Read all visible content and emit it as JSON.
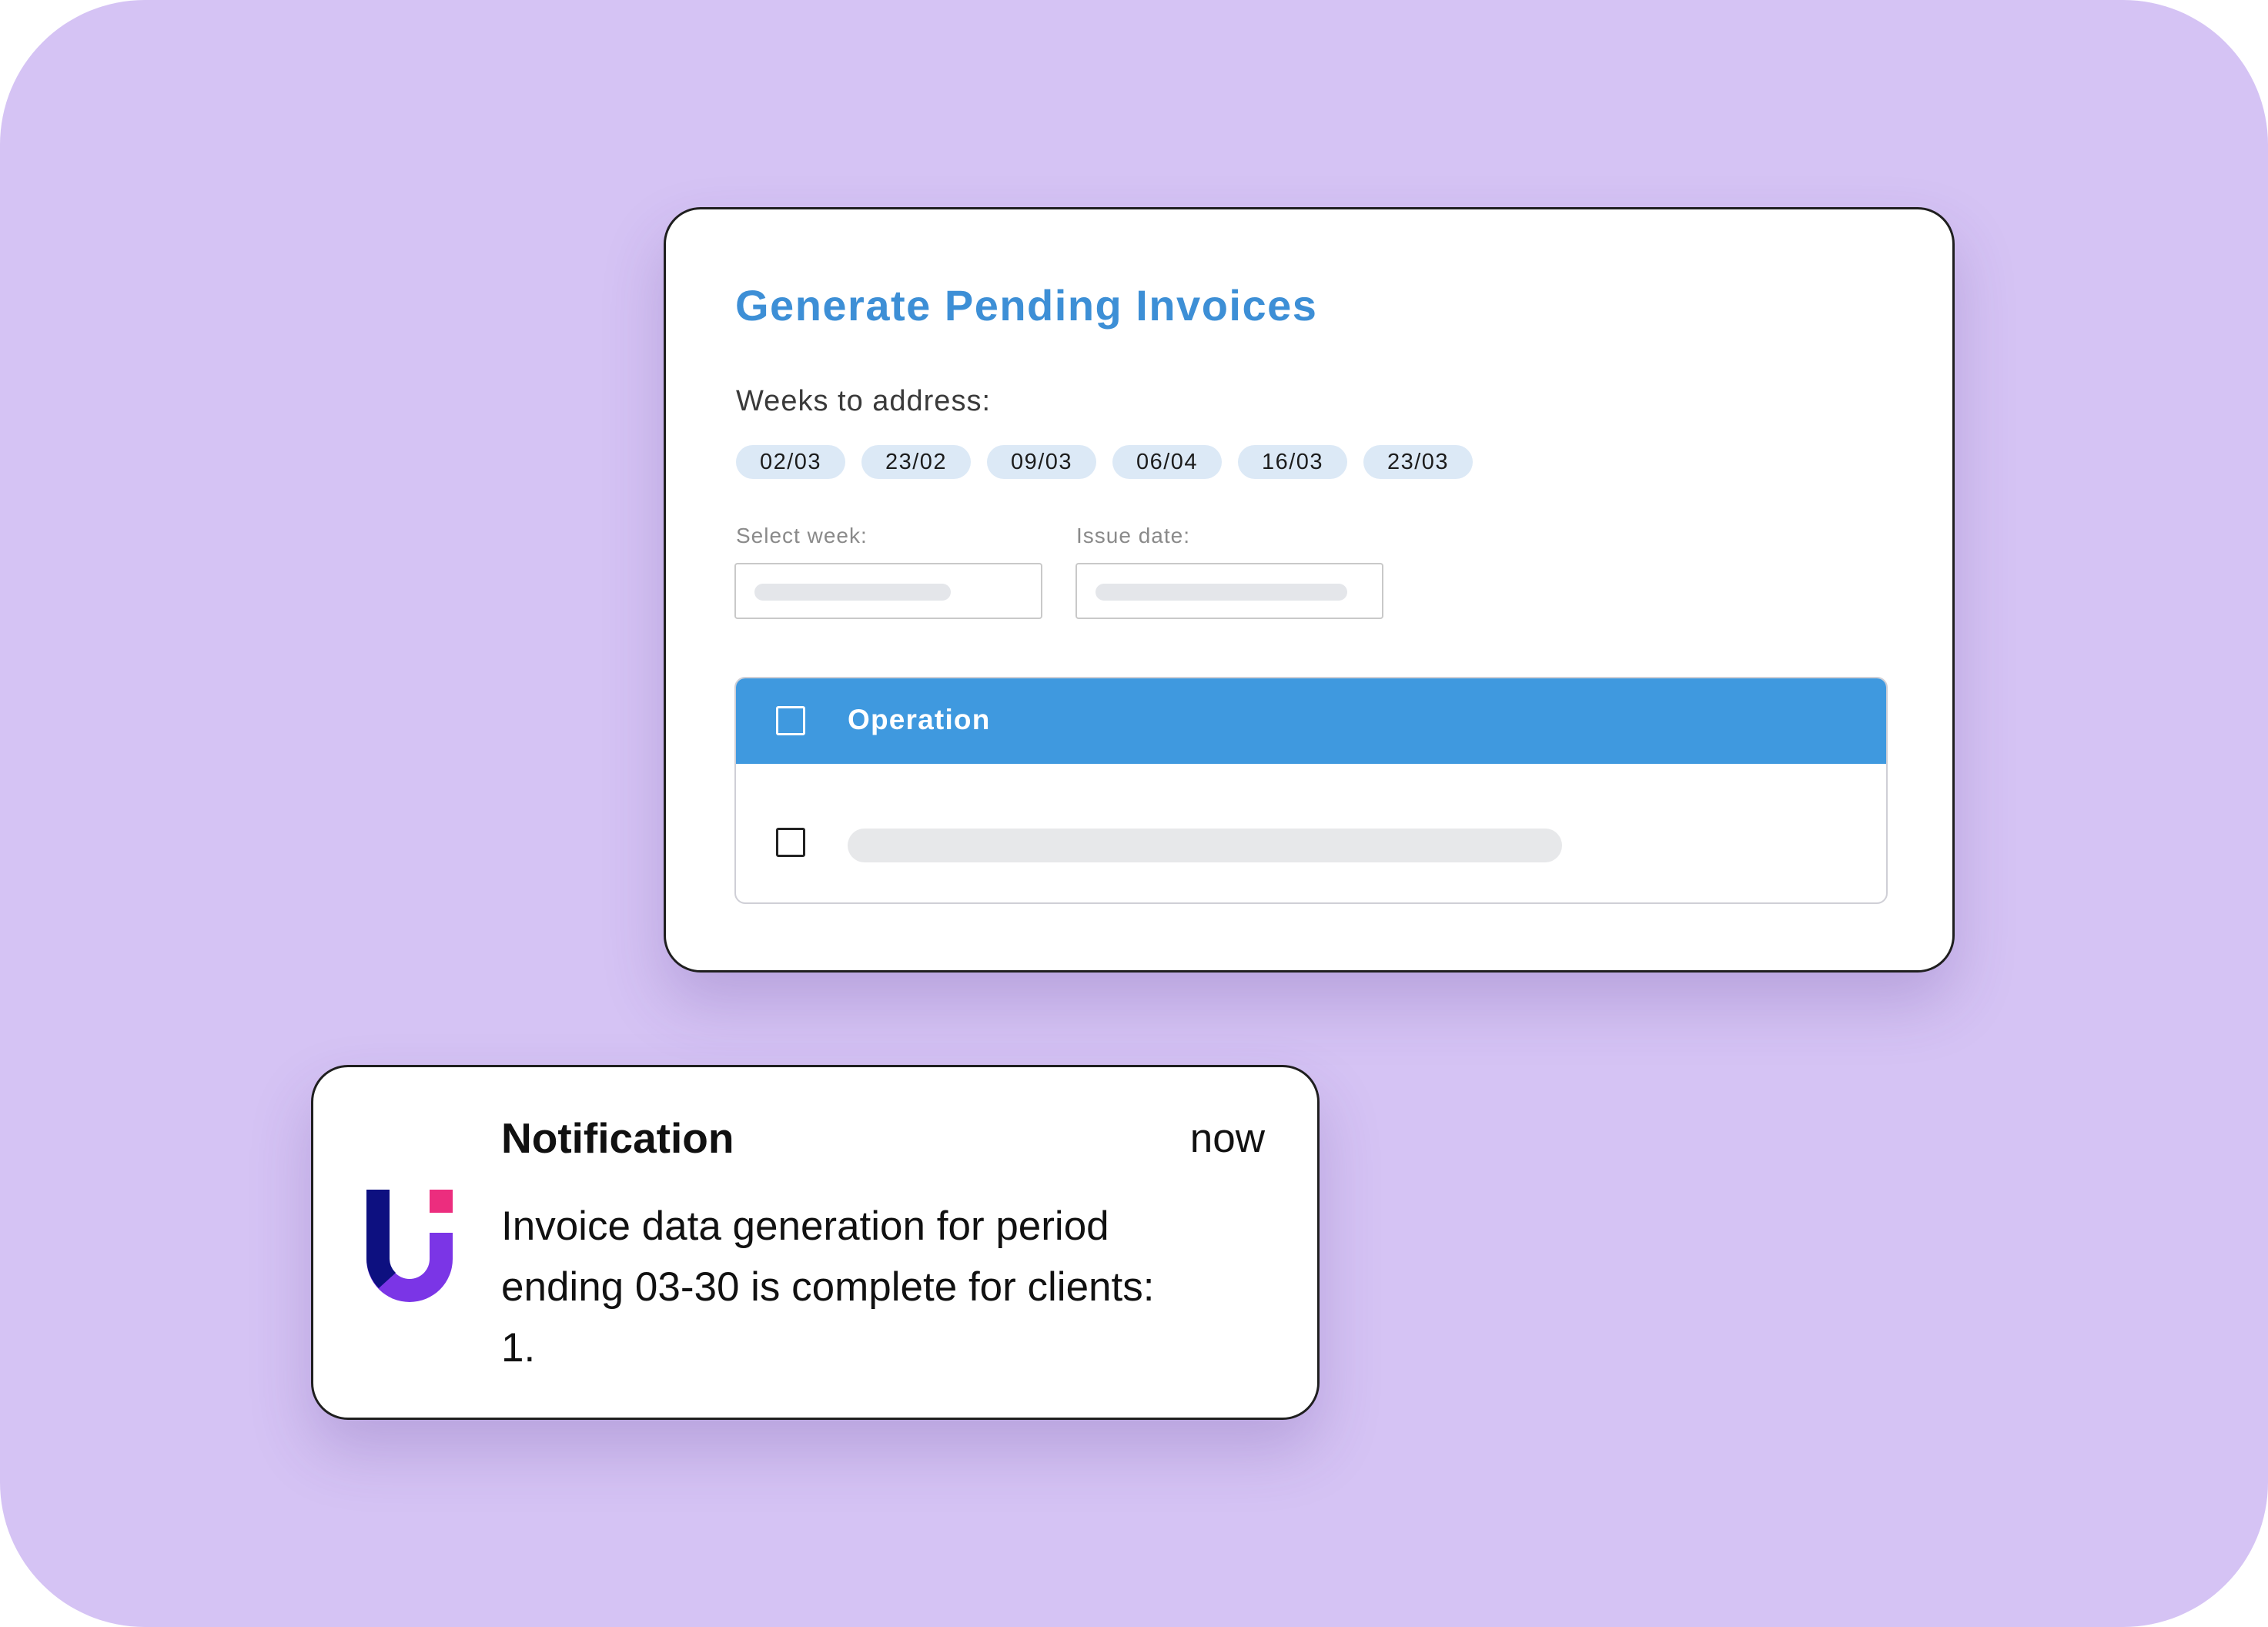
{
  "invoice_panel": {
    "title": "Generate Pending Invoices",
    "weeks_label": "Weeks to address:",
    "weeks": [
      "02/03",
      "23/02",
      "09/03",
      "06/04",
      "16/03",
      "23/03"
    ],
    "select_week_label": "Select week:",
    "issue_date_label": "Issue date:",
    "table": {
      "header": "Operation"
    }
  },
  "notification": {
    "title": "Notification",
    "time": "now",
    "message": "Invoice data generation for period ending 03-30 is complete for clients: 1."
  },
  "colors": {
    "background": "#d5c3f4",
    "title_blue": "#3d8fd6",
    "table_header_blue": "#3f99df",
    "chip_background": "#dce9f6",
    "logo_navy": "#0d1080",
    "logo_purple": "#7b35e6",
    "logo_pink": "#ec2d7e"
  },
  "icons": {
    "app_logo": "u-logo-icon"
  }
}
